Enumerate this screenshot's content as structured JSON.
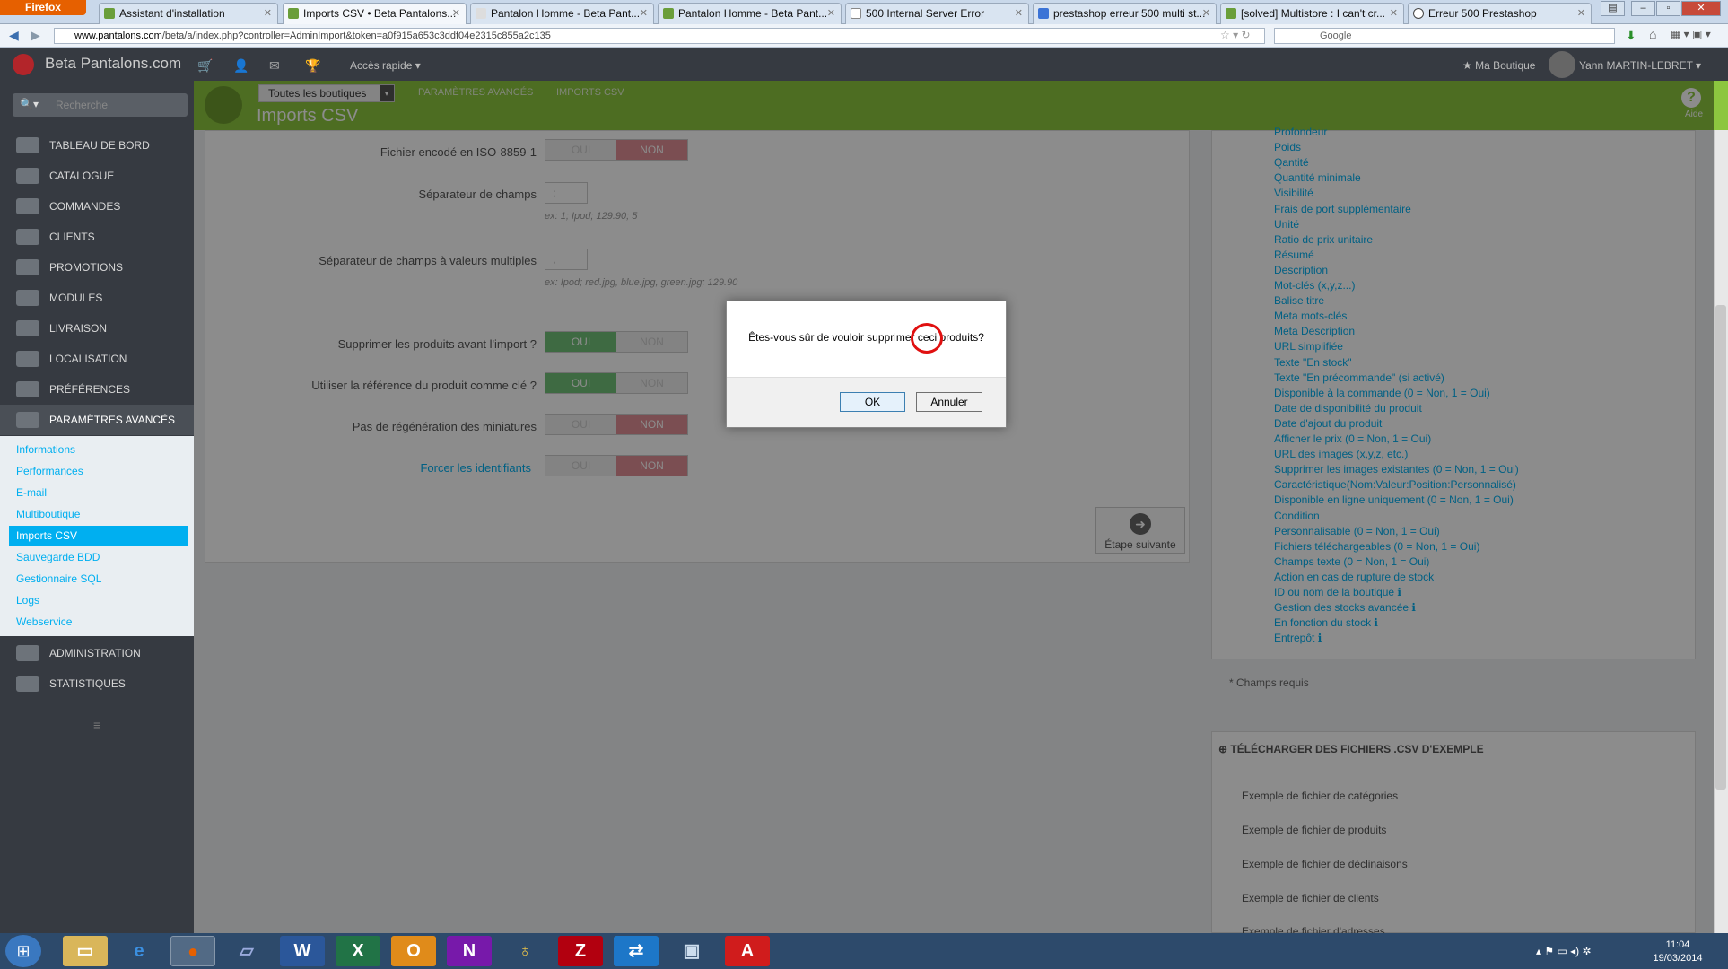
{
  "browser": {
    "menu_label": "Firefox",
    "tabs": [
      {
        "label": "Assistant d'installation"
      },
      {
        "label": "Imports CSV • Beta Pantalons..."
      },
      {
        "label": "Pantalon Homme - Beta Pant..."
      },
      {
        "label": "Pantalon Homme - Beta Pant..."
      },
      {
        "label": "500 Internal Server Error"
      },
      {
        "label": "prestashop erreur 500 multi st..."
      },
      {
        "label": "[solved] Multistore : I can't cr..."
      },
      {
        "label": "Erreur 500 Prestashop"
      }
    ],
    "url_host": "www.pantalons.com",
    "url_path": "/beta/a/index.php?controller=AdminImport&token=a0f915a653c3ddf04e2315c855a2c135",
    "search_engine": "Google"
  },
  "header": {
    "brand": "Beta Pantalons.com",
    "quick_access": "Accès rapide ▾",
    "shop_link": "★ Ma Boutique",
    "user_name": "Yann MARTIN-LEBRET ▾"
  },
  "sidebar": {
    "search_placeholder": "Recherche",
    "items": [
      {
        "label": "Tableau de bord"
      },
      {
        "label": "Catalogue"
      },
      {
        "label": "Commandes"
      },
      {
        "label": "Clients"
      },
      {
        "label": "Promotions"
      },
      {
        "label": "Modules"
      },
      {
        "label": "Livraison"
      },
      {
        "label": "Localisation"
      },
      {
        "label": "Préférences"
      },
      {
        "label": "Paramètres avancés"
      }
    ],
    "subitems": [
      {
        "label": "Informations"
      },
      {
        "label": "Performances"
      },
      {
        "label": "E-mail"
      },
      {
        "label": "Multiboutique"
      },
      {
        "label": "Imports CSV"
      },
      {
        "label": "Sauvegarde BDD"
      },
      {
        "label": "Gestionnaire SQL"
      },
      {
        "label": "Logs"
      },
      {
        "label": "Webservice"
      }
    ],
    "bottom_items": [
      {
        "label": "Administration"
      },
      {
        "label": "Statistiques"
      }
    ]
  },
  "toolbar": {
    "shop_select": "Toutes les boutiques",
    "breadcrumb_1": "PARAMÈTRES AVANCÉS",
    "breadcrumb_2": "IMPORTS CSV",
    "page_title": "Imports CSV",
    "help_label": "Aide"
  },
  "form": {
    "iso_label": "Fichier encodé en ISO-8859-1",
    "field_sep_label": "Séparateur de champs",
    "field_sep_value": ";",
    "field_sep_hint": "ex: 1; Ipod; 129.90; 5",
    "multi_sep_label": "Séparateur de champs à valeurs multiples",
    "multi_sep_value": ",",
    "multi_sep_hint": "ex: Ipod; red.jpg, blue.jpg, green.jpg; 129.90",
    "delete_label": "Supprimer les produits avant l'import ?",
    "ref_key_label": "Utiliser la référence du produit comme clé ?",
    "no_regen_label": "Pas de régénération des miniatures",
    "force_ids_label": "Forcer les identifiants",
    "yes": "OUI",
    "no": "NON",
    "next_step": "Étape suivante"
  },
  "right_fields": [
    "Profondeur",
    "Poids",
    "Qantité",
    "Quantité minimale",
    "Visibilité",
    "Frais de port supplémentaire",
    "Unité",
    "Ratio de prix unitaire",
    "Résumé",
    "Description",
    "Mot-clés (x,y,z...)",
    "Balise titre",
    "Meta mots-clés",
    "Meta Description",
    "URL simplifiée",
    "Texte \"En stock\"",
    "Texte \"En précommande\" (si activé)",
    "Disponible à la commande (0 = Non, 1 = Oui)",
    "Date de disponibilité du produit",
    "Date d'ajout du produit",
    "Afficher le prix (0 = Non, 1 = Oui)",
    "URL des images (x,y,z, etc.)",
    "Supprimer les images existantes (0 = Non, 1 = Oui)",
    "Caractéristique(Nom:Valeur:Position:Personnalisé)",
    "Disponible en ligne uniquement (0 = Non, 1 = Oui)",
    "Condition",
    "Personnalisable (0 = Non, 1 = Oui)",
    "Fichiers téléchargeables (0 = Non, 1 = Oui)",
    "Champs texte (0 = Non, 1 = Oui)",
    "Action en cas de rupture de stock",
    "ID ou nom de la boutique ℹ",
    "Gestion des stocks avancée ℹ",
    "En fonction du stock ℹ",
    "Entrepôt ℹ"
  ],
  "required_note": "* Champs requis",
  "downloads": {
    "title": "⊕ TÉLÉCHARGER DES FICHIERS .CSV D'EXEMPLE",
    "items": [
      "Exemple de fichier de catégories",
      "Exemple de fichier de produits",
      "Exemple de fichier de déclinaisons",
      "Exemple de fichier de clients",
      "Exemple de fichier d'adresses"
    ]
  },
  "dialog": {
    "message": "Êtes-vous sûr de vouloir supprimer ceci produits?",
    "ok": "OK",
    "cancel": "Annuler"
  },
  "taskbar": {
    "time": "11:04",
    "date": "19/03/2014"
  }
}
